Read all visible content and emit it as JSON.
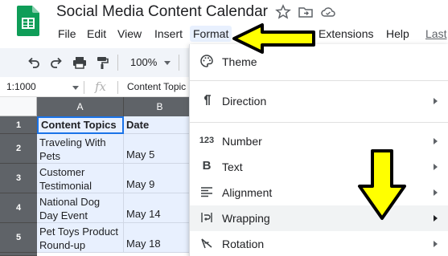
{
  "app": {
    "title": "Social Media Content Calendar"
  },
  "menubar": {
    "items": [
      "File",
      "Edit",
      "View",
      "Insert",
      "Format",
      "Extensions",
      "Help",
      "Last"
    ],
    "active": "Format"
  },
  "toolbar": {
    "zoom": "100%",
    "icons": [
      "undo-icon",
      "redo-icon",
      "print-icon",
      "paint-format-icon"
    ]
  },
  "formula_bar": {
    "name_box": "1:1000",
    "fx": "fx",
    "content": "Content Topic"
  },
  "sheet": {
    "columns": [
      "A",
      "B"
    ],
    "rows": [
      {
        "num": "1",
        "a": "Content Topics",
        "b": "Date"
      },
      {
        "num": "2",
        "a": "Traveling With Pets",
        "b": "May 5"
      },
      {
        "num": "3",
        "a": "Customer Testimonial",
        "b": "May 9"
      },
      {
        "num": "4",
        "a": "National Dog Day Event",
        "b": "May 14"
      },
      {
        "num": "5",
        "a": "Pet Toys Product Round-up",
        "b": "May 18"
      }
    ]
  },
  "format_menu": {
    "items": [
      {
        "label": "Theme",
        "icon": "palette-icon",
        "submenu": false
      },
      {
        "label": "Direction",
        "icon": "paragraph-icon",
        "submenu": true
      },
      {
        "label": "Number",
        "icon": "number-format-icon",
        "icon_text": "123",
        "submenu": true
      },
      {
        "label": "Text",
        "icon": "bold-icon",
        "icon_text": "B",
        "submenu": true
      },
      {
        "label": "Alignment",
        "icon": "align-left-icon",
        "submenu": true
      },
      {
        "label": "Wrapping",
        "icon": "wrap-icon",
        "submenu": true,
        "hover": true
      },
      {
        "label": "Rotation",
        "icon": "rotation-icon",
        "submenu": true
      }
    ]
  },
  "colors": {
    "accent": "#1a73e8",
    "annotation": "#ffff00",
    "header_gray": "#5f6368",
    "selection": "#e8f0fe"
  }
}
